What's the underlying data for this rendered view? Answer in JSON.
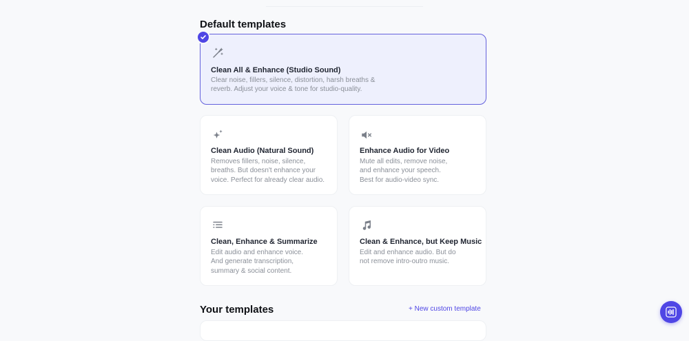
{
  "default_section": {
    "title": "Default templates"
  },
  "templates": [
    {
      "title": "Clean All & Enhance (Studio Sound)",
      "desc_lines": [
        "Clear noise, fillers, silence, distortion, harsh breaths &",
        "reverb. Adjust your voice & tone for studio-quality."
      ],
      "icon": "magic-wand-icon",
      "selected": true
    },
    {
      "title": "Clean Audio (Natural Sound)",
      "desc_lines": [
        "Removes fillers, noise, silence,",
        "breaths. But doesn't enhance your",
        "voice. Perfect for already clear audio."
      ],
      "icon": "sparkles-icon",
      "selected": false
    },
    {
      "title": "Enhance Audio for Video",
      "desc_lines": [
        "Mute all edits, remove noise,",
        "and enhance your speech.",
        "Best for audio-video sync."
      ],
      "icon": "volume-mute-icon",
      "selected": false
    },
    {
      "title": "Clean, Enhance & Summarize",
      "desc_lines": [
        "Edit audio and enhance voice.",
        "And generate transcription,",
        "summary & social content."
      ],
      "icon": "list-icon",
      "selected": false
    },
    {
      "title": "Clean & Enhance, but Keep Music",
      "desc_lines": [
        "Edit and enhance audio. But do",
        "not remove intro-outro music."
      ],
      "icon": "music-note-icon",
      "selected": false
    }
  ],
  "your_section": {
    "title": "Your templates",
    "new_link": "+ New custom template"
  },
  "colors": {
    "accent": "#4f46e5",
    "selected_bg": "#eef0fd",
    "icon_gray": "#8a8f98"
  }
}
